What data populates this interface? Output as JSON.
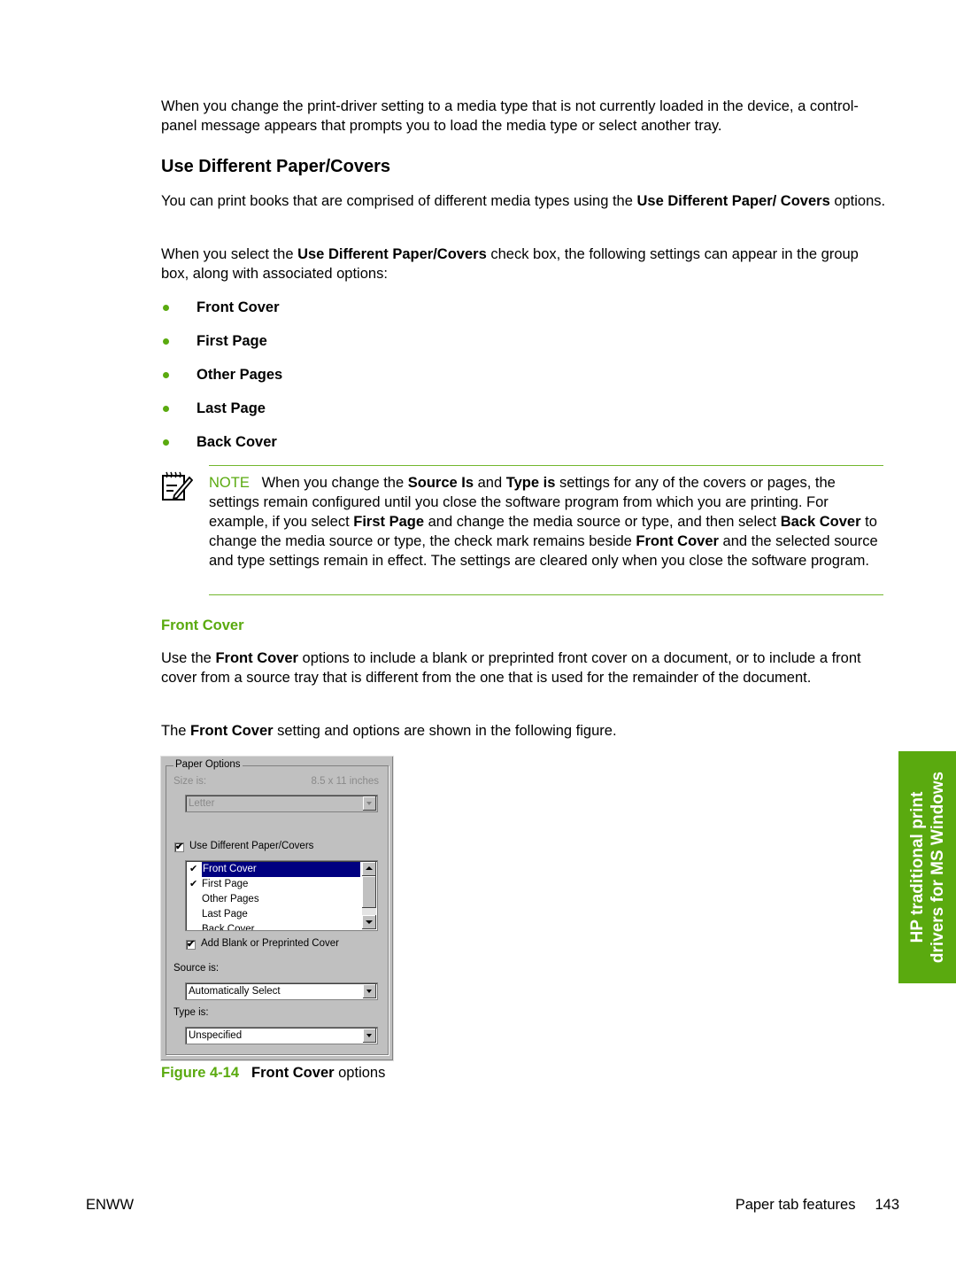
{
  "intro": {
    "text": "When you change the print-driver setting to a media type that is not currently loaded in the device, a control-panel message appears that prompts you to load the media type or select another tray."
  },
  "section": {
    "title": "Use Different Paper/Covers",
    "p1_a": "You can print books that are comprised of different media types using the ",
    "p1_b": "Use Different Paper/ Covers",
    "p1_c": " options.",
    "p2_a": "When you select the ",
    "p2_b": "Use Different Paper/Covers",
    "p2_c": " check box, the following settings can appear in the group box, along with associated options:",
    "bullets": [
      "Front Cover",
      "First Page",
      "Other Pages",
      "Last Page",
      "Back Cover"
    ]
  },
  "note": {
    "label": "NOTE",
    "s1": "When you change the ",
    "b1": "Source Is",
    "s2": " and ",
    "b2": "Type is",
    "s3": " settings for any of the covers or pages, the settings remain configured until you close the software program from which you are printing. For example, if you select ",
    "b3": "First Page",
    "s4": " and change the media source or type, and then select ",
    "b4": "Back Cover",
    "s5": " to change the media source or type, the check mark remains beside ",
    "b5": "Front Cover",
    "s6": " and the selected source and type settings remain in effect. The settings are cleared only when you close the software program."
  },
  "front_cover": {
    "title": "Front Cover",
    "p1_a": "Use the ",
    "p1_b": "Front Cover",
    "p1_c": " options to include a blank or preprinted front cover on a document, or to include a front cover from a source tray that is different from the one that is used for the remainder of the document.",
    "p2_a": "The ",
    "p2_b": "Front Cover",
    "p2_c": " setting and options are shown in the following figure."
  },
  "dialog": {
    "group_title": "Paper Options",
    "size_label": "Size is:",
    "size_value": "8.5 x 11 inches",
    "size_combo": "Letter",
    "use_diff_label": "Use Different Paper/Covers",
    "use_diff_checked": true,
    "list_items": [
      {
        "label": "Front Cover",
        "checked": true,
        "selected": true
      },
      {
        "label": "First Page",
        "checked": true,
        "selected": false
      },
      {
        "label": "Other Pages",
        "checked": false,
        "selected": false
      },
      {
        "label": "Last Page",
        "checked": false,
        "selected": false
      },
      {
        "label": "Back Cover",
        "checked": false,
        "selected": false
      }
    ],
    "add_blank_label": "Add Blank or Preprinted Cover",
    "add_blank_checked": true,
    "source_label": "Source is:",
    "source_value": "Automatically Select",
    "type_label": "Type is:",
    "type_value": "Unspecified",
    "check_glyph": "✔"
  },
  "figure": {
    "number": "Figure 4-14",
    "caption_bold": "Front Cover",
    "caption_rest": " options"
  },
  "side_tab": {
    "line1": "HP traditional print",
    "line2": "drivers for MS Windows"
  },
  "footer": {
    "left": "ENWW",
    "section": "Paper tab features",
    "page": "143"
  },
  "colors": {
    "accent_green": "#5aaa0f",
    "selection_blue": "#000080"
  }
}
